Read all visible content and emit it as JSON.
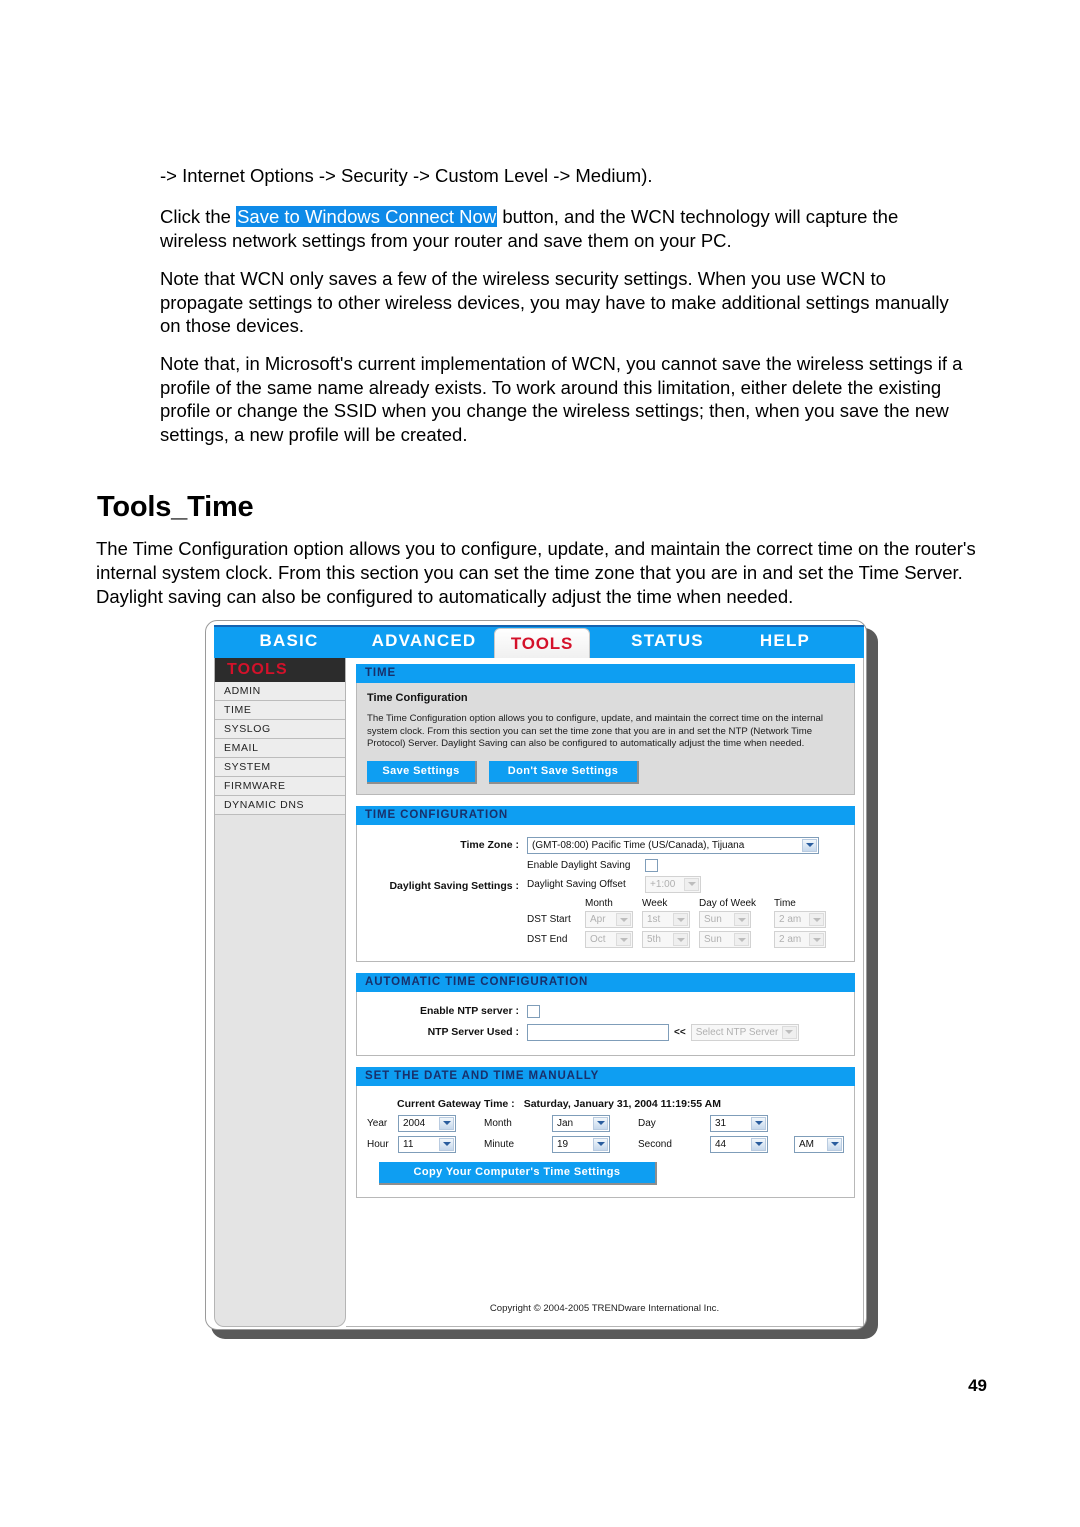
{
  "document": {
    "paragraphs": {
      "p1": "-> Internet Options -> Security -> Custom Level -> Medium).",
      "p2_before": "Click the ",
      "p2_highlight": "Save to Windows Connect Now",
      "p2_after": " button, and the WCN technology will capture the wireless network settings from your router and save them on your PC.",
      "p3": "Note that WCN only saves a few of the wireless security settings. When you use WCN to propagate settings to other wireless devices, you may have to make additional settings manually on those devices.",
      "p4": "Note that, in Microsoft's current implementation of WCN, you cannot save the wireless settings if a profile of the same name already exists. To work around this limitation, either delete the existing profile or change the SSID when you change the wireless settings; then, when you save the new settings, a new profile will be created.",
      "p5": "The Time Configuration option allows you to configure, update, and maintain the correct time on the router's internal system clock. From this section you can set the time zone that you are in and set the Time Server. Daylight saving can also be configured to automatically adjust the time when needed."
    },
    "section_title": "Tools_Time",
    "page_number": "49",
    "highlight_color": "#0e8ae8"
  },
  "router": {
    "topnav": {
      "items": [
        {
          "label": "BASIC",
          "active": false
        },
        {
          "label": "ADVANCED",
          "active": false
        },
        {
          "label": "TOOLS",
          "active": true
        },
        {
          "label": "STATUS",
          "active": false
        },
        {
          "label": "HELP",
          "active": false
        }
      ],
      "bar_color": "#0e9ef2",
      "active_text_color": "#d4112a"
    },
    "sidebar": {
      "heading": "TOOLS",
      "items": [
        "ADMIN",
        "TIME",
        "SYSLOG",
        "EMAIL",
        "SYSTEM",
        "FIRMWARE",
        "DYNAMIC DNS"
      ]
    },
    "time_panel": {
      "header": "TIME",
      "subheading": "Time Configuration",
      "description": "The Time Configuration option allows you to configure, update, and maintain the correct time on the internal system clock. From this section you can set the time zone that you are in and set the NTP (Network Time Protocol) Server. Daylight Saving can also be configured to automatically adjust the time when needed.",
      "save_button": "Save Settings",
      "dont_save_button": "Don't Save Settings"
    },
    "time_configuration": {
      "header": "TIME CONFIGURATION",
      "timezone_label": "Time Zone :",
      "timezone_value": "(GMT-08:00) Pacific Time (US/Canada), Tijuana",
      "dst_settings_label": "Daylight Saving Settings :",
      "enable_dst_label": "Enable Daylight Saving",
      "enable_dst_checked": false,
      "dst_offset_label": "Daylight Saving Offset",
      "dst_offset_value": "+1:00",
      "columns": [
        "Month",
        "Week",
        "Day of Week",
        "Time"
      ],
      "rows": [
        {
          "label": "DST Start",
          "month": "Apr",
          "week": "1st",
          "day_of_week": "Sun",
          "time": "2 am"
        },
        {
          "label": "DST End",
          "month": "Oct",
          "week": "5th",
          "day_of_week": "Sun",
          "time": "2 am"
        }
      ]
    },
    "automatic_time_configuration": {
      "header": "AUTOMATIC TIME CONFIGURATION",
      "enable_ntp_label": "Enable NTP server :",
      "enable_ntp_checked": false,
      "ntp_server_used_label": "NTP Server Used :",
      "ntp_server_value": "",
      "arrows": "<<",
      "select_ntp_server": "Select NTP Server"
    },
    "manual_date_time": {
      "header": "SET THE DATE AND TIME MANUALLY",
      "current_gateway_time_label": "Current Gateway Time :",
      "current_gateway_time_value": "Saturday, January 31, 2004 11:19:55 AM",
      "year_label": "Year",
      "year_value": "2004",
      "month_label": "Month",
      "month_value": "Jan",
      "day_label": "Day",
      "day_value": "31",
      "hour_label": "Hour",
      "hour_value": "11",
      "minute_label": "Minute",
      "minute_value": "19",
      "second_label": "Second",
      "second_value": "44",
      "ampm_value": "AM",
      "copy_button": "Copy Your Computer's Time Settings"
    },
    "copyright": "Copyright © 2004-2005 TRENDware International Inc."
  }
}
